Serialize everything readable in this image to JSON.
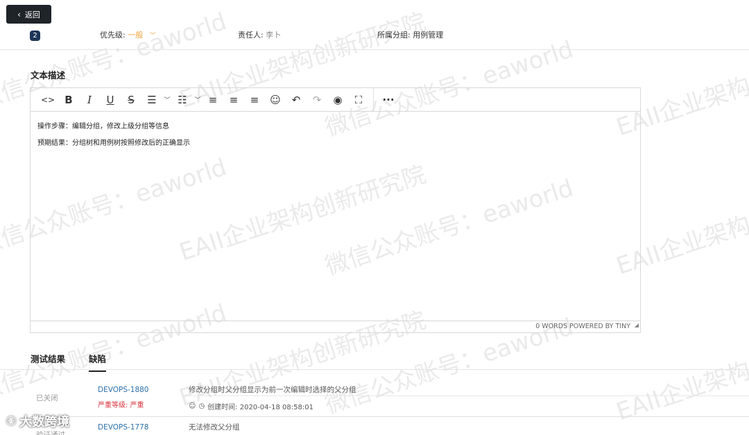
{
  "back_button": {
    "label": "返回"
  },
  "info": {
    "step_badge": "2",
    "priority_label": "优先级:",
    "priority_value": "一般",
    "owner_label": "责任人:",
    "owner_value": "李卜",
    "group_label": "所属分组:",
    "group_value": "用例管理"
  },
  "section_title": "文本描述",
  "editor": {
    "lines": [
      "操作步骤：编辑分组，修改上级分组等信息",
      "预期结果：分组树和用例树按照修改后的正确显示"
    ],
    "status": "0 WORDS  POWERED BY TINY"
  },
  "tabs": [
    {
      "label": "测试结果"
    },
    {
      "label": "缺陷"
    }
  ],
  "defects": [
    {
      "status": "已关闭",
      "id": "DEVOPS-1880",
      "severity": "严重等级: 严重",
      "title": "修改分组时父分组显示为前一次编辑时选择的父分组",
      "created": "创建时间: 2020-04-18 08:58:01"
    },
    {
      "status": "验证通过",
      "id": "DEVOPS-1778",
      "title": "无法修改父分组"
    }
  ],
  "watermarks": [
    "EAII企业架构创新研究院",
    "微信公众账号：eaworld"
  ],
  "logo_text": "大数跨境"
}
